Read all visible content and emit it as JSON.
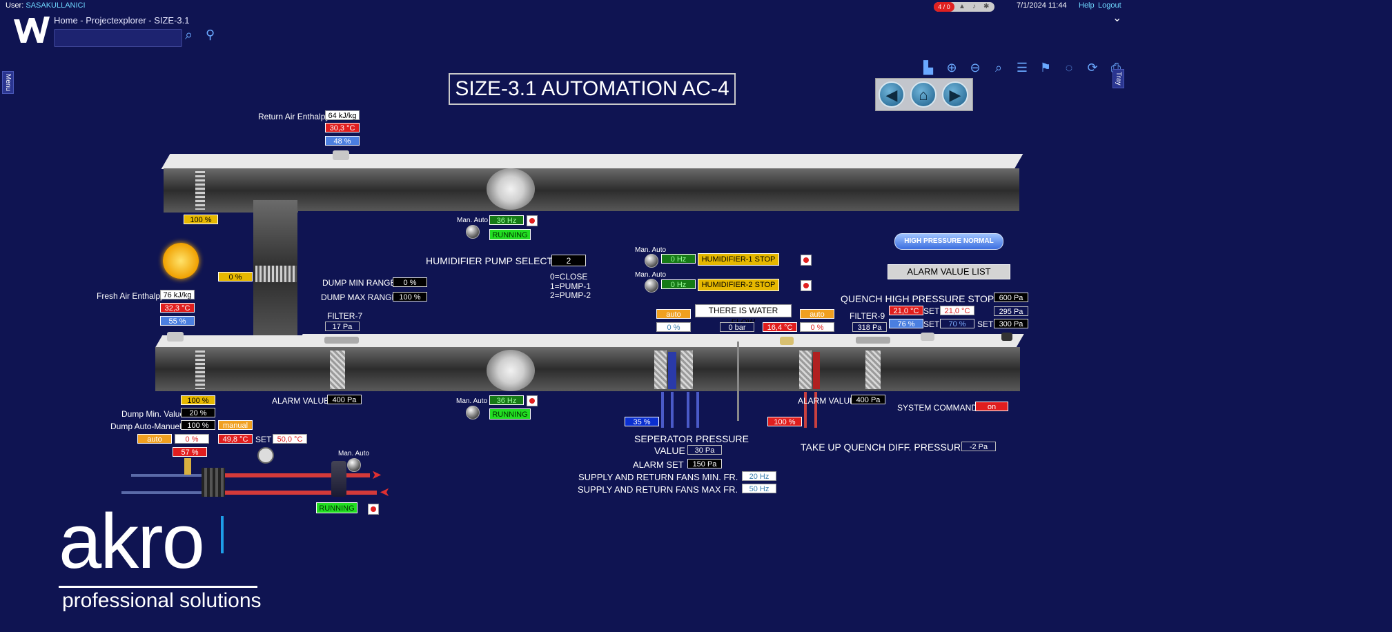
{
  "topbar": {
    "user_label": "User:",
    "user_name": "SASAKULLANICI",
    "alarm_counter": "4 / 0",
    "datetime": "7/1/2024 11:44",
    "help": "Help",
    "logout": "Logout"
  },
  "header": {
    "breadcrumb": "Home - Projectexplorer - SIZE-3.1",
    "search_placeholder": "",
    "side_menu": "Menu",
    "side_tray": "Tray",
    "toolbar_icons": [
      "chart-icon",
      "zoom-in-icon",
      "zoom-out-icon",
      "search-icon",
      "list-icon",
      "bookmark-icon",
      "comment-icon",
      "refresh-icon",
      "print-icon"
    ]
  },
  "page": {
    "title": "SIZE-3.1 AUTOMATION AC-4",
    "high_pressure_normal": "HIGH PRESSURE NORMAL",
    "alarm_value_list": "ALARM VALUE LIST"
  },
  "return_air": {
    "enthalpy_label": "Return Air Enthalpy",
    "enthalpy": "64 kJ/kg",
    "temp": "30,3 °C",
    "humidity": "48 %",
    "damper": "100 %"
  },
  "fresh_air": {
    "enthalpy_label": "Fresh Air Enthalpy",
    "enthalpy": "76 kJ/kg",
    "temp": "32,3 °C",
    "humidity": "55 %",
    "damper": "100 %"
  },
  "mixing_damper": "0 %",
  "return_fan": {
    "man_auto": "Man. Auto",
    "hz": "36 Hz",
    "status": "RUNNING"
  },
  "supply_fan": {
    "man_auto": "Man. Auto",
    "hz": "36 Hz",
    "status": "RUNNING"
  },
  "dump": {
    "min_range_label": "DUMP MIN RANGE",
    "min_range": "0 %",
    "max_range_label": "DUMP MAX RANGE",
    "max_range": "100 %",
    "min_value_label": "Dump Min. Value",
    "min_value": "20 %",
    "auto_manuel_label": "Dump Auto-Manuel",
    "auto_manuel": "100 %",
    "manual": "manual"
  },
  "filter7": {
    "label": "FILTER-7",
    "value": "17 Pa",
    "alarm_label": "ALARM VALUE",
    "alarm": "400 Pa"
  },
  "heating": {
    "mode": "auto",
    "valve": "0 %",
    "temp": "49,8 °C",
    "set_label": "SET",
    "set": "50,0 °C",
    "output": "57 %",
    "man_auto": "Man. Auto",
    "status": "RUNNING"
  },
  "humidifier": {
    "pump_select_label": "HUMIDIFIER PUMP SELECT",
    "pump_select": "2",
    "legend": [
      "0=CLOSE",
      "1=PUMP-1",
      "2=PUMP-2"
    ],
    "h1_man_auto": "Man. Auto",
    "h1_hz": "0 Hz",
    "h1_status": "HUMIDIFIER-1 STOP",
    "h2_man_auto": "Man. Auto",
    "h2_hz": "0 Hz",
    "h2_status": "HUMIDIFIER-2 STOP",
    "water_flow": "THERE IS WATER FLOW"
  },
  "cooling": {
    "mode": "auto",
    "valve": "0 %",
    "output": "35 %"
  },
  "pressure_sensor": "0 bar",
  "reheat": {
    "temp": "16,4 °C",
    "mode": "auto",
    "valve": "0 %",
    "output": "100 %"
  },
  "filter9": {
    "label": "FILTER-9",
    "value": "318 Pa",
    "alarm_label": "ALARM VALUE",
    "alarm": "400 Pa"
  },
  "supply_air": {
    "temp": "21,0 °C",
    "temp_set_label": "SET",
    "temp_set": "21,0 °C",
    "humidity": "76 %",
    "hum_set_label": "SET",
    "hum_set": "70 %",
    "pressure_set_label": "SET",
    "pressure_set": "300 Pa",
    "pressure": "295 Pa"
  },
  "quench": {
    "label": "QUENCH HIGH PRESSURE STOP",
    "value": "600 Pa",
    "diff_label": "TAKE UP QUENCH DIFF. PRESSURE",
    "diff": "-2 Pa"
  },
  "system_command": {
    "label": "SYSTEM COMMAND",
    "value": "on"
  },
  "separator": {
    "label_line1": "SEPERATOR PRESSURE",
    "label_line2": "VALUE",
    "value": "30 Pa",
    "alarm_set_label": "ALARM SET",
    "alarm_set": "150 Pa",
    "fans_min_label": "SUPPLY AND RETURN FANS MIN. FR.",
    "fans_min": "20 Hz",
    "fans_max_label": "SUPPLY AND RETURN FANS MAX FR.",
    "fans_max": "50 Hz"
  },
  "brand": {
    "logo": "akro",
    "tagline": "professional solutions"
  }
}
